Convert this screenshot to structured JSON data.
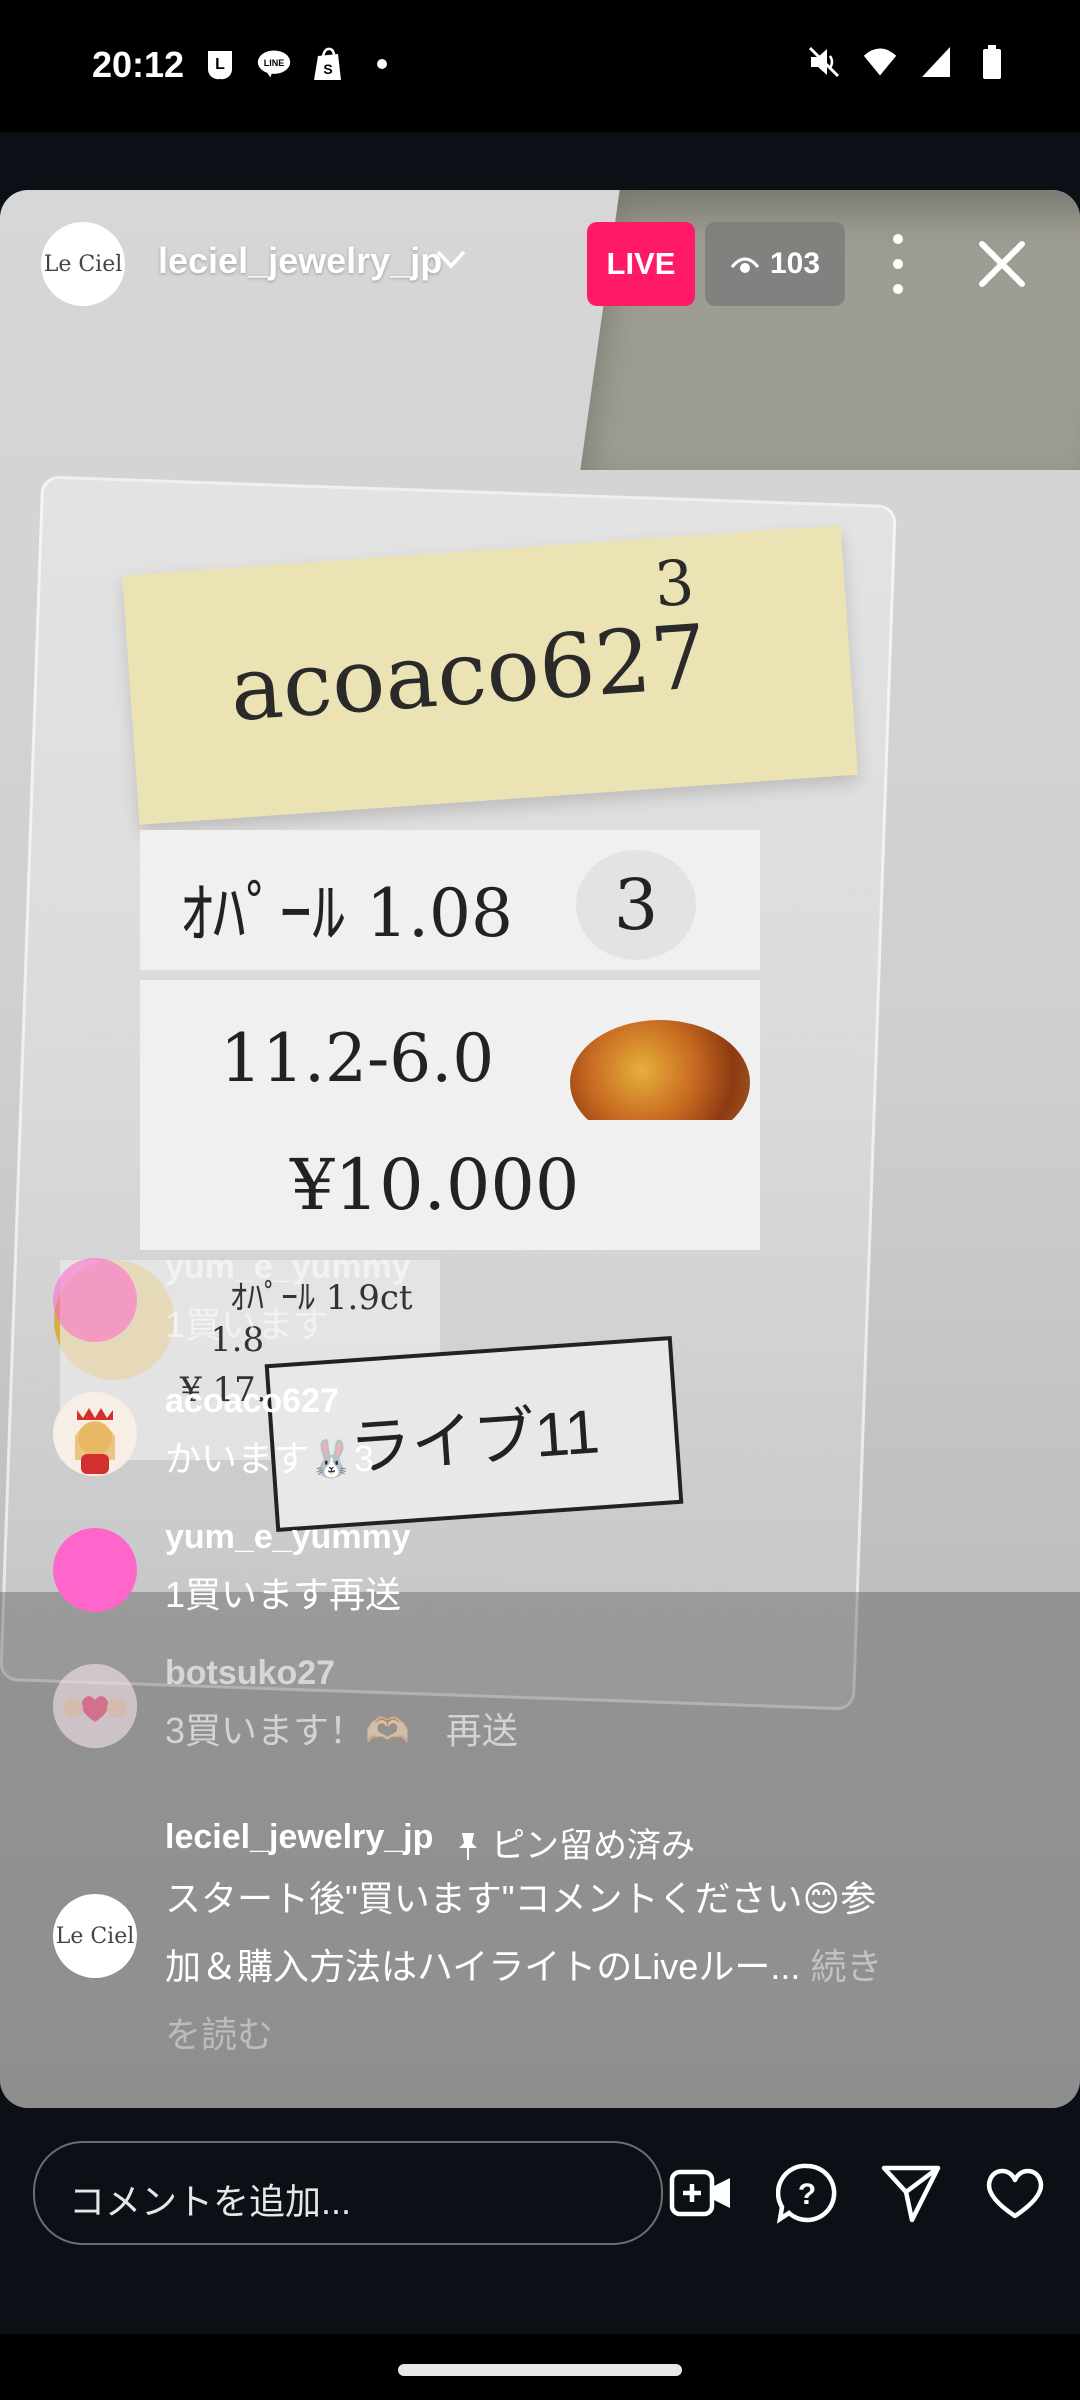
{
  "status_bar": {
    "time": "20:12",
    "left_icons": [
      "line-icon",
      "line-chat-icon",
      "shopify-icon",
      "dot-icon"
    ],
    "right_icons": [
      "mute-icon",
      "wifi-icon",
      "signal-icon",
      "battery-icon"
    ]
  },
  "stream": {
    "host_name": "leciel_jewelry_jp",
    "host_avatar_text": "Le Ciel",
    "live_label": "LIVE",
    "viewer_count": "103",
    "scene": {
      "note_handwriting": "acoaco627",
      "note_number": "3",
      "card1_text": "ｵﾊﾟｰﾙ 1.08",
      "card1_circle": "3",
      "card2_text": "11.2-6.0",
      "card3_text": "¥10.000",
      "old_tag_lines": [
        "ｵﾊﾟｰﾙ 1.9ct",
        "1.8",
        "¥ 17.000"
      ],
      "live_label_text": "ライブ11"
    }
  },
  "comments": [
    {
      "user": "yum_e_yummy",
      "text": "1買います",
      "avatar_color": "#ff66cc"
    },
    {
      "user": "acoaco627",
      "text": "かいます🐰3",
      "avatar_color": "#f4e3c7"
    },
    {
      "user": "yum_e_yummy",
      "text": "1買います再送",
      "avatar_color": "#ff66cc"
    },
    {
      "user": "botsuko27",
      "text": "3買います！🫶🏻　再送",
      "avatar_color": "#f2d5e0"
    }
  ],
  "pinned_comment": {
    "user": "leciel_jewelry_jp",
    "tag": "ピン留め済み",
    "line1": "スタート後\"買います\"コメントください😊参",
    "line2": "加＆購入方法はハイライトのLiveルー...",
    "more": "続き",
    "line3": "を読む"
  },
  "bottom_bar": {
    "comment_placeholder": "コメントを追加...",
    "icons": [
      "add-video-icon",
      "question-icon",
      "send-icon",
      "heart-icon"
    ]
  },
  "colors": {
    "live_red": "#ff1a66",
    "background": "#0b0f16"
  }
}
